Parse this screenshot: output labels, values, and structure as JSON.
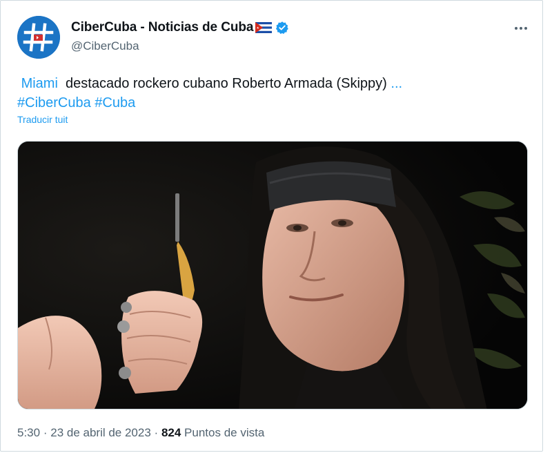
{
  "account": {
    "display_name": "CiberCuba - Noticias de Cuba",
    "handle": "@CiberCuba",
    "flag_icon": "cuba-flag-icon",
    "verified_icon": "verified-badge-icon",
    "brand_color": "#1b74c5",
    "verified_color": "#1d9bf0"
  },
  "tweet": {
    "location_tag": "Miami",
    "text": "destacado rockero cubano Roberto Armada (Skippy)",
    "ellipsis": "...",
    "hashtag_1": "#CiberCuba",
    "hashtag_2": "#Cuba",
    "translate_label": "Traducir tuit"
  },
  "media": {
    "description_icon": "photo-man-with-long-hair-and-headband"
  },
  "footer": {
    "time": "5:30",
    "separator": "·",
    "date": "23 de abril de 2023",
    "views_count": "824",
    "views_label": "Puntos de vista"
  },
  "colors": {
    "link": "#1d9bf0",
    "secondary_text": "#536471",
    "primary_text": "#0f1419"
  }
}
